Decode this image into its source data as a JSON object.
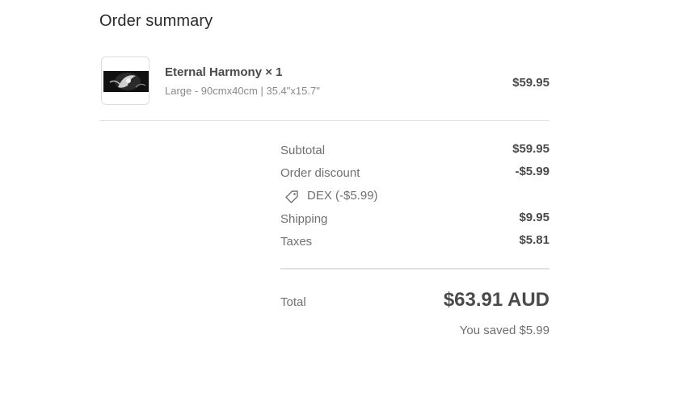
{
  "summary": {
    "title": "Order summary"
  },
  "item": {
    "thumbnail_icon": "product-image",
    "name": "Eternal Harmony × 1",
    "variant": "Large - 90cmx40cm | 35.4\"x15.7\"",
    "price": "$59.95"
  },
  "totals": {
    "subtotal_label": "Subtotal",
    "subtotal_value": "$59.95",
    "discount_label": "Order discount",
    "discount_value": "-$5.99",
    "discount_code_icon": "tag-icon",
    "discount_code": "DEX (-$5.99)",
    "shipping_label": "Shipping",
    "shipping_value": "$9.95",
    "taxes_label": "Taxes",
    "taxes_value": "$5.81",
    "total_label": "Total",
    "total_value": "$63.91 AUD",
    "saved_text": "You saved $5.99"
  }
}
